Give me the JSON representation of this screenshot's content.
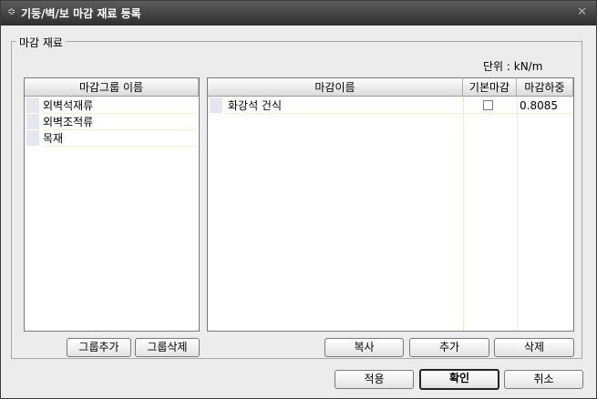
{
  "window": {
    "title": "기둥/벽/보 마감 재료 등록",
    "app_icon": "chevron-up-down-icon",
    "close_icon": "close-icon"
  },
  "groupbox": {
    "label": "마감 재료"
  },
  "unit_label": "단위 : kN/m",
  "group_list": {
    "header": "마감그룹 이름",
    "items": [
      "외벽석재류",
      "외벽조적류",
      "목재"
    ]
  },
  "material_table": {
    "columns": [
      "마감이름",
      "기본마감",
      "마감하중"
    ],
    "rows": [
      {
        "name": "화강석 건식",
        "default": false,
        "load": "0.8085"
      }
    ]
  },
  "buttons": {
    "add_group": "그룹추가",
    "delete_group": "그룹삭제",
    "copy": "복사",
    "add": "추가",
    "delete": "삭제",
    "apply": "적용",
    "ok": "확인",
    "cancel": "취소"
  }
}
